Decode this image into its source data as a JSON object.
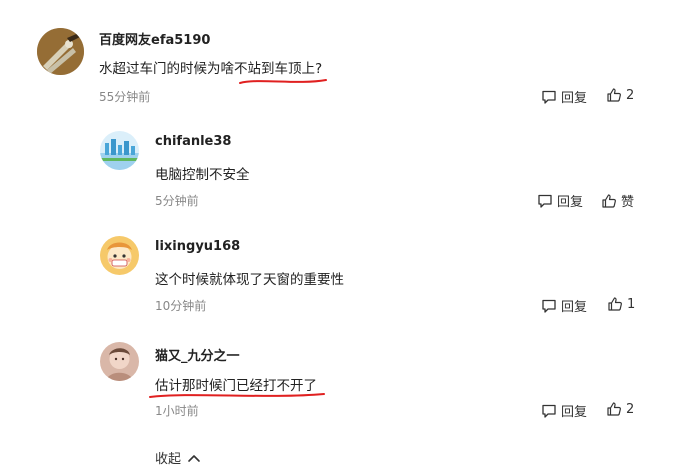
{
  "comments": [
    {
      "user": "百度网友efa5190",
      "text": "水超过车门的时候为啥不站到车顶上?",
      "time": "55分钟前",
      "reply_label": "回复",
      "like_label": "2",
      "avatar": "pliers-photo"
    },
    {
      "user": "chifanle38",
      "text": "电脑控制不安全",
      "time": "5分钟前",
      "reply_label": "回复",
      "like_label": "赞",
      "avatar": "city-skyline"
    },
    {
      "user": "lixingyu168",
      "text": "这个时候就体现了天窗的重要性",
      "time": "10分钟前",
      "reply_label": "回复",
      "like_label": "1",
      "avatar": "cartoon-character"
    },
    {
      "user": "猫又_九分之一",
      "text": "估计那时候门已经打不开了",
      "time": "1小时前",
      "reply_label": "回复",
      "like_label": "2",
      "avatar": "person-photo"
    }
  ],
  "collapse_label": "收起",
  "icons": {
    "reply": "comment-bubble-icon",
    "like": "thumbs-up-icon",
    "collapse": "chevron-up-icon"
  },
  "colors": {
    "annotation_underline": "#e02020",
    "time_text": "#888888"
  }
}
